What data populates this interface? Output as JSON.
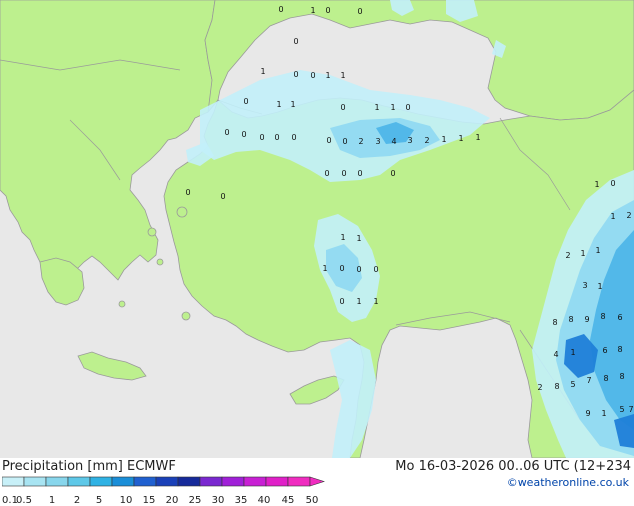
{
  "header": {
    "left_title": "Precipitation [mm] ECMWF",
    "right_title": "Mo 16-03-2026 00..06 UTC (12+234",
    "credit": "©weatheronline.co.uk"
  },
  "legend": {
    "tick_labels": [
      "0.1",
      "0.5",
      "1",
      "2",
      "5",
      "10",
      "15",
      "20",
      "25",
      "30",
      "35",
      "40",
      "45",
      "50"
    ],
    "colors": [
      "#c8f0f8",
      "#a8e4f2",
      "#88d6ec",
      "#5ec8e8",
      "#2fb2e4",
      "#1a8ed8",
      "#2060d0",
      "#1a40b8",
      "#162a9a",
      "#7a28d0",
      "#a020d8",
      "#c820d4",
      "#e020c8",
      "#f02cc0"
    ]
  },
  "colors": {
    "sea": "#e8e8e8",
    "land": "#bdf08e",
    "coast": "#9a9a9a",
    "border": "#9a9a9a",
    "precip_light": "#c2eff9",
    "precip_mid": "#8fd8f2",
    "precip_heavy": "#4ab4e8",
    "precip_core": "#1f7fd8"
  },
  "map_labels": [
    "0",
    "1",
    "0",
    "0",
    "0",
    "1",
    "0",
    "0",
    "1",
    "1",
    "0",
    "1",
    "1",
    "0",
    "1",
    "1",
    "0",
    "0",
    "0",
    "0",
    "0",
    "0",
    "0",
    "0",
    "2",
    "3",
    "4",
    "3",
    "2",
    "1",
    "1",
    "1",
    "0",
    "0",
    "0",
    "0",
    "0",
    "0",
    "1",
    "0",
    "1",
    "1",
    "1",
    "0",
    "0",
    "0",
    "0",
    "1",
    "1",
    "1",
    "2",
    "1",
    "1",
    "2",
    "3",
    "1",
    "8",
    "6",
    "8",
    "8",
    "9",
    "8",
    "6",
    "1",
    "4",
    "2",
    "8",
    "5",
    "7",
    "8",
    "8",
    "9",
    "1",
    "5",
    "7"
  ]
}
